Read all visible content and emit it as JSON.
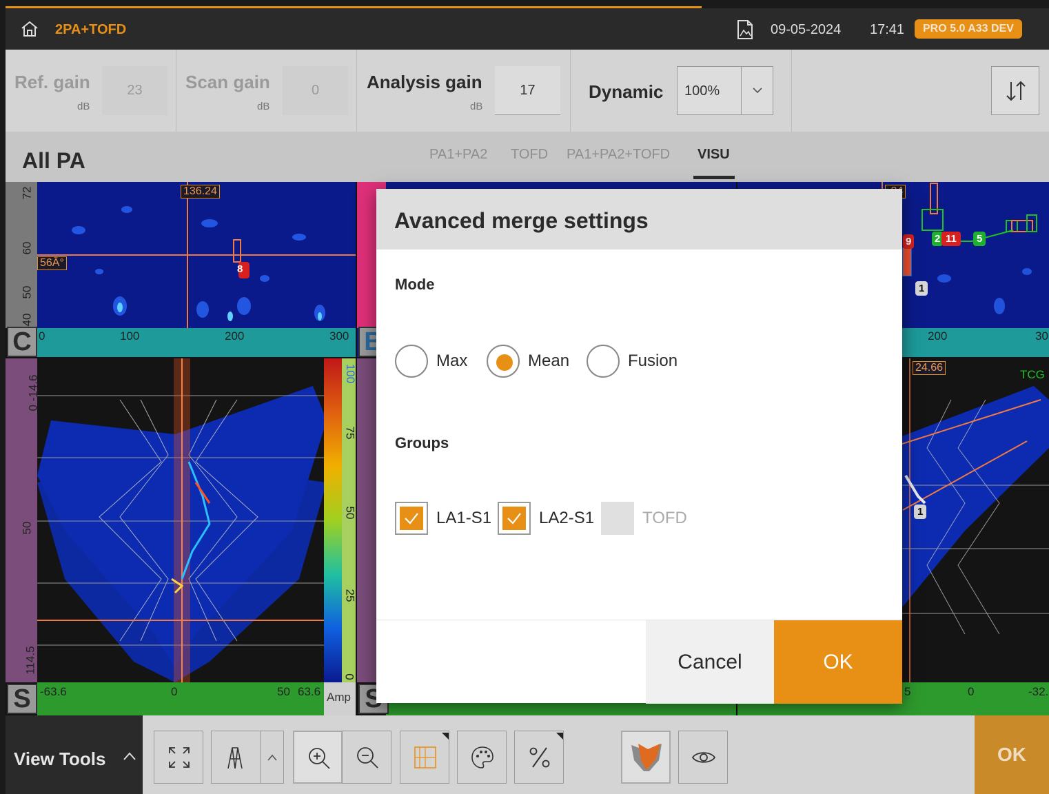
{
  "topbar": {
    "app_name": "2PA+TOFD",
    "date": "09-05-2024",
    "time": "17:41",
    "version": "PRO 5.0 A33 DEV"
  },
  "gains": {
    "ref_label": "Ref. gain",
    "ref_value": "23",
    "scan_label": "Scan gain",
    "scan_value": "0",
    "analysis_label": "Analysis gain",
    "analysis_value": "17",
    "unit": "dB",
    "dynamic_label": "Dynamic",
    "dynamic_value": "100%"
  },
  "titlebar": {
    "title": "All PA",
    "tabs": [
      "PA1+PA2",
      "TOFD",
      "PA1+PA2+TOFD",
      "VISU"
    ],
    "active_tab": "VISU"
  },
  "views": {
    "cscan": {
      "letter": "C",
      "cursor_tag": "136.24",
      "angle_tag": "56Â°",
      "indication": "8",
      "x_ticks": [
        "0",
        "100",
        "200",
        "300"
      ],
      "y_ticks": [
        "72",
        "60",
        "50",
        "40"
      ]
    },
    "sscan_left": {
      "letter": "S",
      "x_ticks": [
        "-63.6",
        "0",
        "50",
        "63.6"
      ],
      "y_ticks": [
        "0 -14.6",
        "50",
        "114.5"
      ],
      "amp_label": "Amp",
      "amp_ticks": [
        "100",
        "75",
        "50",
        "25",
        "0"
      ]
    },
    "bscan": {
      "letter": "B"
    },
    "sscan_mid": {
      "letter": "S"
    },
    "right_top": {
      "cursor_tag": ".24",
      "x_ticks": [
        "200",
        "30"
      ],
      "indications": [
        "9",
        "2",
        "11",
        "5",
        "1"
      ]
    },
    "right_bottom": {
      "cursor_tag": "24.66",
      "tcg_label": "TCG",
      "x_ticks": [
        "5",
        "0",
        "-32."
      ],
      "indication": "1"
    }
  },
  "dialog": {
    "title": "Avanced merge settings",
    "mode_label": "Mode",
    "modes": [
      {
        "label": "Max",
        "selected": false
      },
      {
        "label": "Mean",
        "selected": true
      },
      {
        "label": "Fusion",
        "selected": false
      }
    ],
    "groups_label": "Groups",
    "groups": [
      {
        "label": "LA1-S1",
        "checked": true,
        "enabled": true
      },
      {
        "label": "LA2-S1",
        "checked": true,
        "enabled": true
      },
      {
        "label": "TOFD",
        "checked": false,
        "enabled": false
      }
    ],
    "cancel_label": "Cancel",
    "ok_label": "OK"
  },
  "toolbar": {
    "view_tools_label": "View Tools",
    "ok_label": "OK",
    "icons": [
      "expand-icon",
      "probe-icon",
      "zoom-in-icon",
      "zoom-out-icon",
      "layout-icon",
      "palette-icon",
      "percent-icon",
      "merge-view-icon",
      "eye-icon"
    ]
  },
  "colors": {
    "accent": "#e89016",
    "dark": "#2a2a2a",
    "panel": "#d4d4d4"
  }
}
